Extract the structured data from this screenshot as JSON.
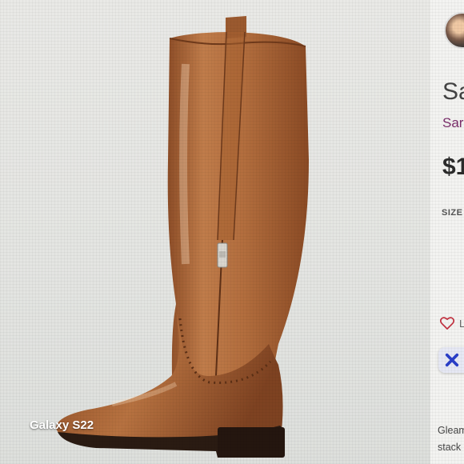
{
  "camera_watermark": "Galaxy S22",
  "product": {
    "image_icon": "tall-brown-leather-riding-boot",
    "title": "Sa",
    "brand": "Sar",
    "price": "$1",
    "size_label": "SIZE",
    "like_count": "L",
    "description_line1": "Gleam",
    "description_line2": "stack"
  },
  "icons": {
    "like": "heart-outline-icon",
    "share": "x-mark-icon",
    "seller_avatar": "avatar"
  },
  "colors": {
    "brand": "#7a2d6a",
    "boot_leather": "#a8643a",
    "share_icon": "#2a3fc9"
  }
}
